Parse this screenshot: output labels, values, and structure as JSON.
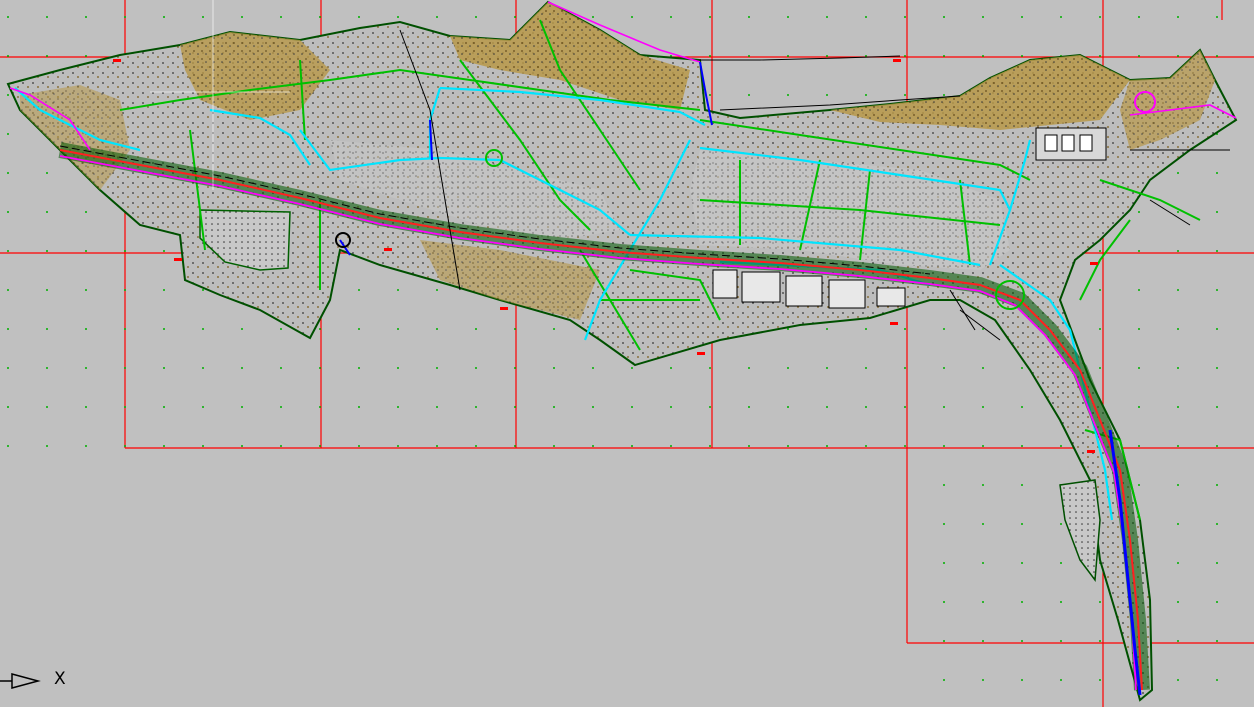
{
  "viewport": {
    "background": "#c0c0c0",
    "grid_color": "#ff0000",
    "dot_color": "#00b000"
  },
  "ucs_icon": {
    "name": "ucs-arrow-icon",
    "axis_label": "X"
  },
  "layer_colors": {
    "boundary": "#006000",
    "paths": "#00c000",
    "water": "#00ffff",
    "highway": "#ff0000",
    "magenta": "#ff00ff",
    "terrain": "#a07820",
    "lines": "#000000",
    "blue": "#0000ff"
  }
}
